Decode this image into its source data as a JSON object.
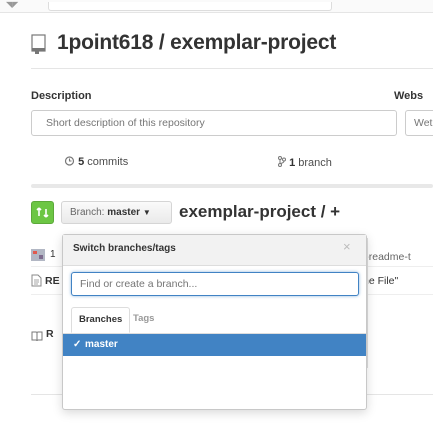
{
  "repo": {
    "title": "1point618 / exemplar-project"
  },
  "description": {
    "label": "Description",
    "placeholder": "Short description of this repository"
  },
  "website": {
    "label": "Webs",
    "placeholder": "Wet"
  },
  "stats": {
    "commits_count": "5",
    "commits_label": "commits",
    "branch_count": "1",
    "branch_label": "branch"
  },
  "branch_selector": {
    "prefix": "Branch:",
    "value": "master"
  },
  "breadcrumb": {
    "text": "exemplar-project / +"
  },
  "dropdown": {
    "title": "Switch branches/tags",
    "close": "×",
    "filter_placeholder": "Find or create a branch...",
    "tabs": [
      "Branches",
      "Tags"
    ],
    "items": [
      {
        "name": "master",
        "selected": true
      }
    ]
  },
  "files": {
    "row1_num": "1",
    "row1_right": "rrt-7-readme-t",
    "row2_name": "RE",
    "row2_right": "ne File\"",
    "row3_name": "R"
  },
  "colors": {
    "accent": "#4183c4",
    "compare_green": "#6cc644"
  },
  "icons": [
    "repo-icon",
    "history-icon",
    "branch-icon",
    "compare-icon",
    "caret-down-icon",
    "close-icon",
    "check-icon",
    "avatar-icon",
    "book-icon"
  ]
}
